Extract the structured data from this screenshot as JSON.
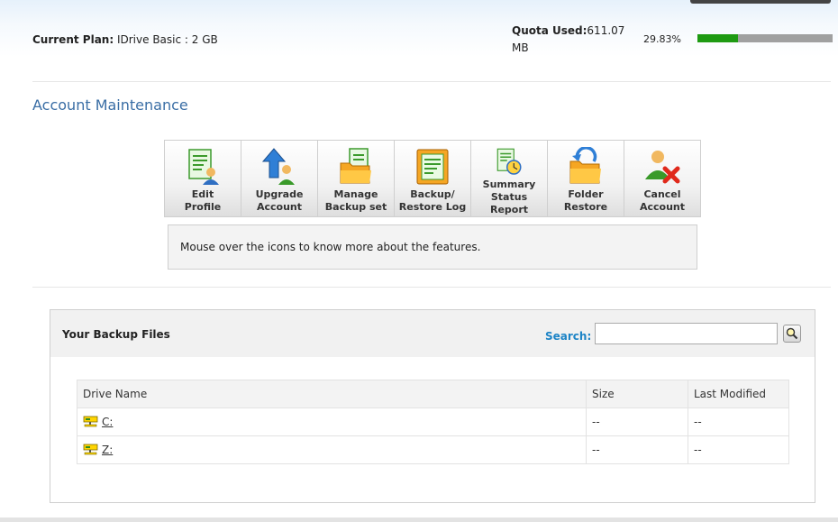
{
  "header": {
    "plan_label": "Current Plan:",
    "plan_value": "IDrive Basic : 2 GB",
    "quota_label": "Quota Used:",
    "quota_value": "611.07 MB",
    "quota_percent_text": "29.83%",
    "quota_fraction": 0.2983
  },
  "section": {
    "title": "Account Maintenance"
  },
  "toolbar": {
    "items": [
      {
        "line1": "Edit",
        "line2": "Profile"
      },
      {
        "line1": "Upgrade",
        "line2": "Account"
      },
      {
        "line1": "Manage",
        "line2": "Backup set"
      },
      {
        "line1": "Backup/",
        "line2": "Restore Log"
      },
      {
        "line1": "Summary",
        "line2": "Status Report"
      },
      {
        "line1": "Folder",
        "line2": "Restore"
      },
      {
        "line1": "Cancel",
        "line2": "Account"
      }
    ]
  },
  "info": {
    "text": "Mouse over the icons to know more about the features."
  },
  "backup_panel": {
    "title": "Your Backup Files",
    "search_label": "Search:",
    "search_value": "",
    "columns": [
      "Drive Name",
      "Size",
      "Last Modified"
    ],
    "rows": [
      {
        "drive": "C:",
        "size": "--",
        "modified": "--"
      },
      {
        "drive": "Z:",
        "size": "--",
        "modified": "--"
      }
    ]
  },
  "colors": {
    "accent_title": "#3a6ea5",
    "search_label": "#1d84c6",
    "quota_fill": "#1e9a12",
    "quota_track": "#a0a0a0"
  },
  "icons": [
    "edit-profile-icon",
    "upgrade-account-icon",
    "manage-backup-set-icon",
    "backup-restore-log-icon",
    "summary-status-report-icon",
    "folder-restore-icon",
    "cancel-account-icon",
    "search-icon",
    "drive-icon"
  ]
}
